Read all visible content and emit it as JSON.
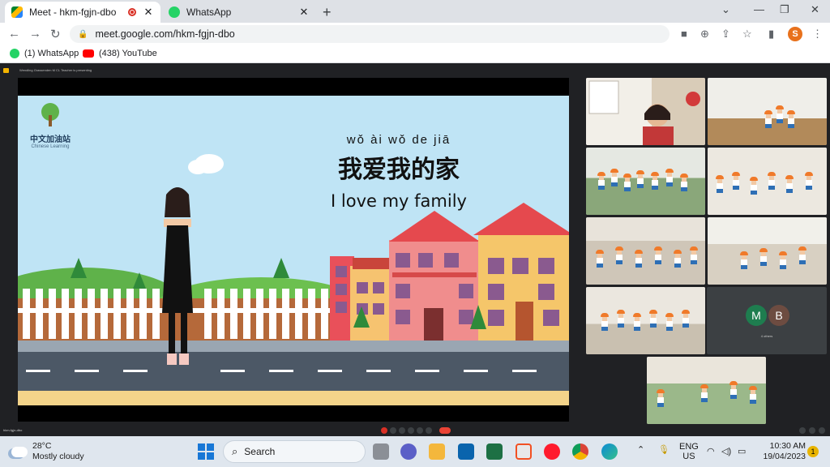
{
  "browser": {
    "tabs": [
      {
        "title": "Meet - hkm-fgjn-dbo",
        "active": true,
        "recording": true
      },
      {
        "title": "WhatsApp",
        "active": false
      }
    ],
    "url": "meet.google.com/hkm-fgjn-dbo",
    "profile_initial": "S",
    "bookmarks": [
      {
        "label": "(1) WhatsApp",
        "icon": "whatsapp-icon"
      },
      {
        "label": "(438) YouTube",
        "icon": "youtube-icon"
      }
    ]
  },
  "meet": {
    "header_text": "Wendling Grassenden M CL Teacher is presenting",
    "slide": {
      "logo_text": "中文加油站",
      "logo_sub": "Chinese Learning",
      "pinyin": "wǒ  ài  wǒ  de  jiā",
      "hanzi": "我爱我的家",
      "english": "I love my family"
    },
    "avatars": [
      {
        "initial": "M",
        "color": "#1e7d4f"
      },
      {
        "initial": "B",
        "color": "#6d4c41"
      }
    ],
    "avatar_caption": "4 others",
    "meeting_code": "hkm-fgjn-dbo"
  },
  "taskbar": {
    "weather_temp": "28°C",
    "weather_desc": "Mostly cloudy",
    "search_label": "Search",
    "lang_top": "ENG",
    "lang_bottom": "US",
    "time": "10:30 AM",
    "date": "19/04/2023",
    "notification_count": "1"
  }
}
